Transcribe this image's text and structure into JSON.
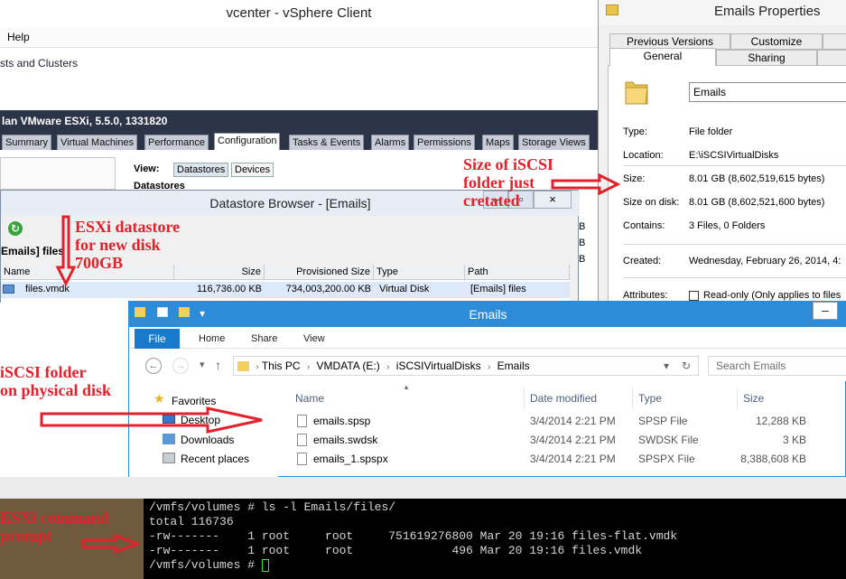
{
  "vsphere": {
    "title": "vcenter - vSphere Client",
    "menu_help": "Help",
    "breadcrumb": "sts and Clusters",
    "host": "lan VMware ESXi, 5.5.0, 1331820",
    "tabs": [
      "Summary",
      "Virtual Machines",
      "Performance",
      "Configuration",
      "Tasks & Events",
      "Alarms",
      "Permissions",
      "Maps",
      "Storage Views"
    ],
    "view_label": "View:",
    "view_buttons": [
      "Datastores",
      "Devices"
    ],
    "datastores_label": "Datastores",
    "right_cells": [
      "B",
      "B",
      "B"
    ]
  },
  "datastore_browser": {
    "title": "Datastore Browser - [Emails]",
    "folder": "Emails] files",
    "close": "×",
    "columns": [
      "Name",
      "Size",
      "Provisioned Size",
      "Type",
      "Path"
    ],
    "row": {
      "name": "files.vmdk",
      "size": "116,736.00 KB",
      "provisioned": "734,003,200.00 KB",
      "type": "Virtual Disk",
      "path": "[Emails] files"
    }
  },
  "properties": {
    "title": "Emails Properties",
    "tabs_top": [
      "Previous Versions",
      "Customize"
    ],
    "tabs_bottom": [
      "General",
      "Sharing"
    ],
    "name_value": "Emails",
    "fields": [
      {
        "label": "Type:",
        "value": "File folder"
      },
      {
        "label": "Location:",
        "value": "E:\\iSCSIVirtualDisks"
      },
      {
        "label": "Size:",
        "value": "8.01 GB (8,602,519,615 bytes)"
      },
      {
        "label": "Size on disk:",
        "value": "8.01 GB (8,602,521,600 bytes)"
      },
      {
        "label": "Contains:",
        "value": "3 Files, 0 Folders"
      },
      {
        "label": "Created:",
        "value": "Wednesday, February 26, 2014, 4:"
      },
      {
        "label": "Attributes:",
        "value": "Read-only (Only applies to files"
      }
    ]
  },
  "explorer": {
    "title": "Emails",
    "ribbon": [
      "File",
      "Home",
      "Share",
      "View"
    ],
    "address": [
      "This PC",
      "VMDATA (E:)",
      "iSCSIVirtualDisks",
      "Emails"
    ],
    "search_placeholder": "Search Emails",
    "nav": [
      "Favorites",
      "Desktop",
      "Downloads",
      "Recent places"
    ],
    "columns": [
      "Name",
      "Date modified",
      "Type",
      "Size"
    ],
    "files": [
      {
        "name": "emails.spsp",
        "date": "3/4/2014 2:21 PM",
        "type": "SPSP File",
        "size": "12,288 KB"
      },
      {
        "name": "emails.swdsk",
        "date": "3/4/2014 2:21 PM",
        "type": "SWDSK File",
        "size": "3 KB"
      },
      {
        "name": "emails_1.spspx",
        "date": "3/4/2014 2:21 PM",
        "type": "SPSPX File",
        "size": "8,388,608 KB"
      }
    ]
  },
  "terminal": {
    "lines": [
      "/vmfs/volumes # ls -l Emails/files/",
      "total 116736",
      "-rw-------    1 root     root     751619276800 Mar 20 19:16 files-flat.vmdk",
      "-rw-------    1 root     root              496 Mar 20 19:16 files.vmdk"
    ],
    "prompt": "/vmfs/volumes # "
  },
  "annotations": {
    "size_note": "Size of iSCSI\nfolder just\ncretated",
    "datastore_note": "ESXi datastore\nfor new disk\n700GB",
    "folder_note": "iSCSI folder\non physical disk",
    "cmd_note": "ESXi command\nprompt"
  },
  "colors": {
    "annotation": "#e3212b",
    "explorer_accent": "#2d8bd8",
    "host_bar": "#2b3547"
  }
}
